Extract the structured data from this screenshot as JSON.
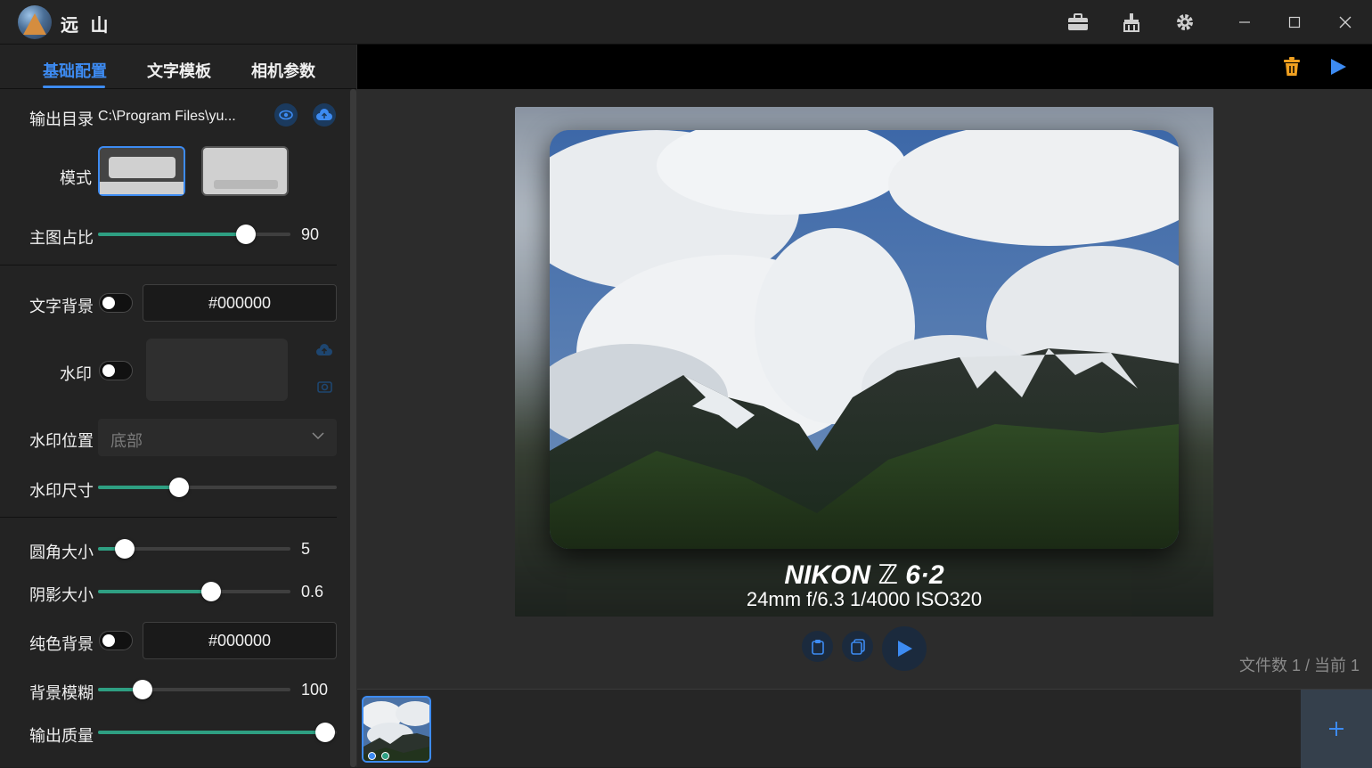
{
  "app": {
    "title": "远 山"
  },
  "tabs": [
    {
      "label": "基础配置",
      "active": true
    },
    {
      "label": "文字模板",
      "active": false
    },
    {
      "label": "相机参数",
      "active": false
    }
  ],
  "settings": {
    "output_dir_label": "输出目录",
    "output_dir_value": "C:\\Program Files\\yu...",
    "mode_label": "模式",
    "main_ratio_label": "主图占比",
    "main_ratio_value": "90",
    "main_ratio_fraction": 0.77,
    "text_bg_label": "文字背景",
    "text_bg_color": "#000000",
    "watermark_label": "水印",
    "watermark_pos_label": "水印位置",
    "watermark_pos_value": "底部",
    "watermark_size_label": "水印尺寸",
    "watermark_size_fraction": 0.34,
    "corner_label": "圆角大小",
    "corner_value": "5",
    "corner_fraction": 0.14,
    "shadow_label": "阴影大小",
    "shadow_value": "0.6",
    "shadow_fraction": 0.59,
    "solid_bg_label": "纯色背景",
    "solid_bg_color": "#000000",
    "bg_blur_label": "背景模糊",
    "bg_blur_value": "100",
    "bg_blur_fraction": 0.23,
    "quality_label": "输出质量",
    "quality_fraction": 0.95
  },
  "preview": {
    "camera": "NIKON ℤ 6·2",
    "params": "24mm f/6.3 1/4000 ISO320"
  },
  "status": {
    "file_count": "文件数 1 / 当前 1"
  },
  "colors": {
    "accent": "#3d8bf2",
    "slider": "#2e9f82",
    "delete": "#f0a020"
  }
}
